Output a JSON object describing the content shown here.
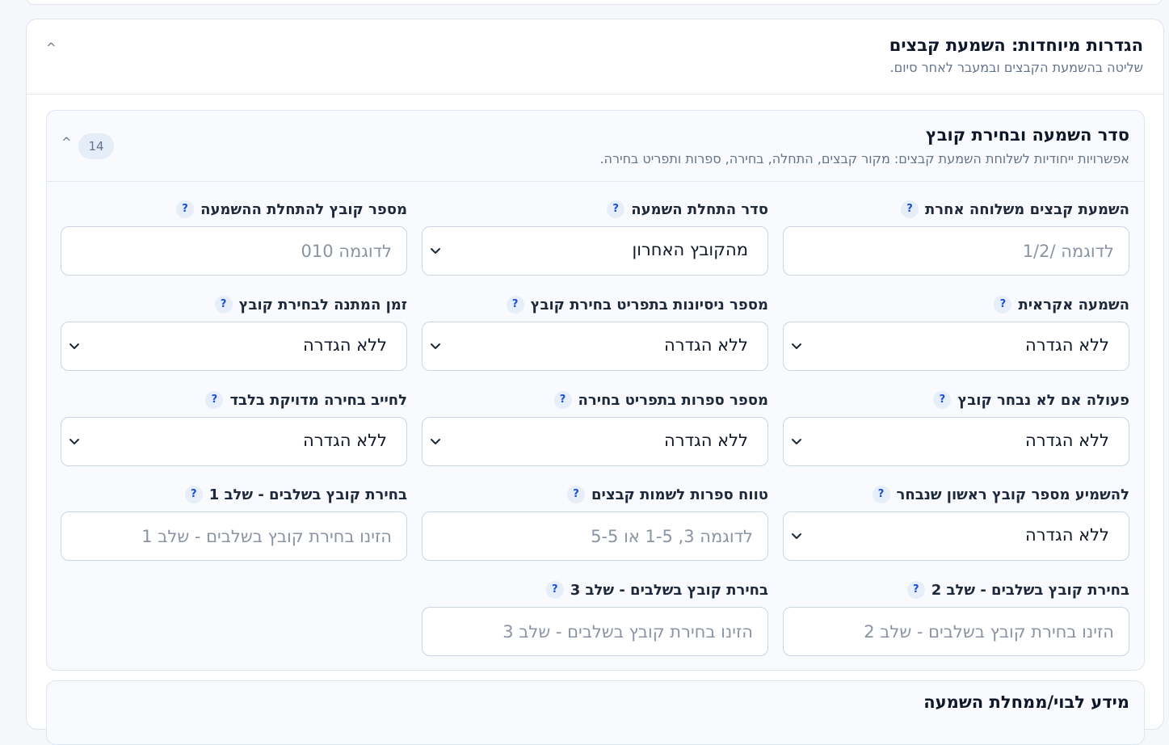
{
  "outer": {
    "title": "הגדרות מיוחדות: השמעת קבצים",
    "subtitle": "שליטה בהשמעת הקבצים ובמעבר לאחר סיום.",
    "caret": "^"
  },
  "section": {
    "title": "סדר השמעה ובחירת קובץ",
    "subtitle": "אפשרויות ייחודיות לשלוחת השמעת קבצים: מקור קבצים, התחלה, בחירה, ספרות ותפריט בחירה.",
    "count": "14",
    "caret": "^"
  },
  "help_glyph": "?",
  "fields": [
    {
      "label": "השמעת קבצים משלוחה אחרת",
      "type": "input",
      "placeholder": "לדוגמה /1/2",
      "value": ""
    },
    {
      "label": "סדר התחלת השמעה",
      "type": "select",
      "value": "מהקובץ האחרון"
    },
    {
      "label": "מספר קובץ להתחלת ההשמעה",
      "type": "input",
      "placeholder": "לדוגמה 010",
      "value": ""
    },
    {
      "label": "השמעה אקראית",
      "type": "select",
      "value": "ללא הגדרה"
    },
    {
      "label": "מספר ניסיונות בתפריט בחירת קובץ",
      "type": "select",
      "value": "ללא הגדרה"
    },
    {
      "label": "זמן המתנה לבחירת קובץ",
      "type": "select",
      "value": "ללא הגדרה"
    },
    {
      "label": "פעולה אם לא נבחר קובץ",
      "type": "select",
      "value": "ללא הגדרה"
    },
    {
      "label": "מספר ספרות בתפריט בחירה",
      "type": "select",
      "value": "ללא הגדרה"
    },
    {
      "label": "לחייב בחירה מדויקת בלבד",
      "type": "select",
      "value": "ללא הגדרה"
    },
    {
      "label": "להשמיע מספר קובץ ראשון שנבחר",
      "type": "select",
      "value": "ללא הגדרה"
    },
    {
      "label": "טווח ספרות לשמות קבצים",
      "type": "input",
      "placeholder": "לדוגמה 3, 1-5 או 5-5",
      "value": ""
    },
    {
      "label": "בחירת קובץ בשלבים - שלב 1",
      "type": "input",
      "placeholder": "הזינו בחירת קובץ בשלבים - שלב 1",
      "value": ""
    },
    {
      "label": "בחירת קובץ בשלבים - שלב 2",
      "type": "input",
      "placeholder": "הזינו בחירת קובץ בשלבים - שלב 2",
      "value": ""
    },
    {
      "label": "בחירת קובץ בשלבים - שלב 3",
      "type": "input",
      "placeholder": "הזינו בחירת קובץ בשלבים - שלב 3",
      "value": ""
    }
  ],
  "next_section": {
    "title": "מידע לבוי/ממחלת השמעה"
  },
  "icons": {
    "select_arrow": "chevron-down-icon",
    "help": "help-icon",
    "collapse": "chevron-up-icon"
  },
  "colors": {
    "accent": "#1d4ed8",
    "help_bg": "#e6eefa",
    "border": "#cbd5e1"
  }
}
